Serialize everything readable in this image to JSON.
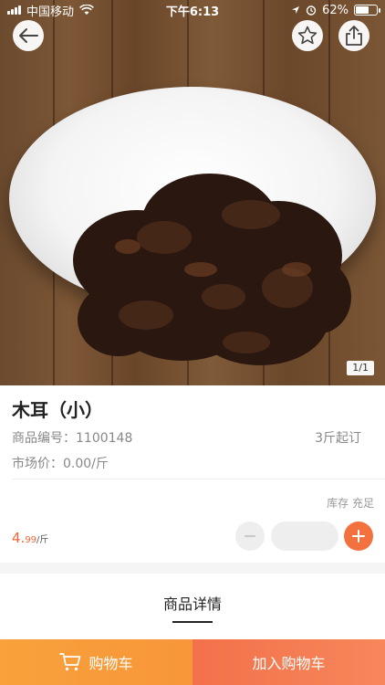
{
  "status_bar": {
    "carrier": "中国移动",
    "time": "下午6:13",
    "battery_percent": "62%"
  },
  "header": {
    "back_icon": "back-arrow-icon",
    "favorite_icon": "star-icon",
    "share_icon": "share-icon"
  },
  "gallery": {
    "counter": "1/1"
  },
  "product": {
    "name": "木耳（小）",
    "sku_label": "商品编号：",
    "sku": "1100148",
    "moq": "3斤起订",
    "market_price_label": "市场价：",
    "market_price": "0.00/斤",
    "stock_label": "库存",
    "stock_status": "充足",
    "price_int": "4.",
    "price_dec": "99",
    "price_unit": "/斤"
  },
  "quantity": {
    "value": "",
    "minus_icon": "minus-icon",
    "plus_icon": "plus-icon"
  },
  "detail_tab": {
    "label": "商品详情"
  },
  "bottom_bar": {
    "cart_label": "购物车",
    "add_label": "加入购物车"
  },
  "colors": {
    "accent": "#f3713f",
    "price": "#f0663a",
    "cart_button": "#f9a13b",
    "add_button": "#f3714a"
  }
}
